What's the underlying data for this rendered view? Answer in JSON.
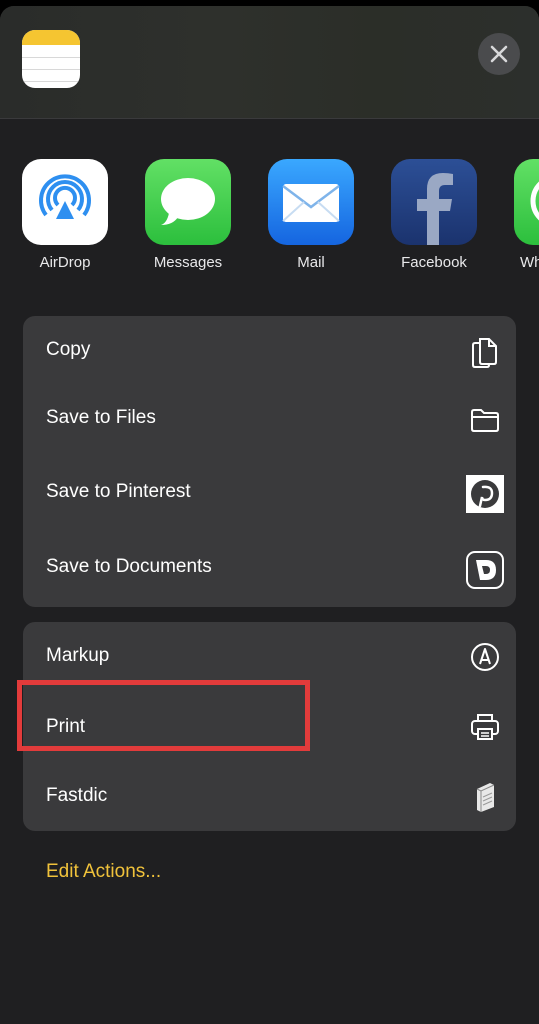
{
  "apps": [
    {
      "label": "AirDrop",
      "icon": "airdrop-icon"
    },
    {
      "label": "Messages",
      "icon": "messages-icon"
    },
    {
      "label": "Mail",
      "icon": "mail-icon"
    },
    {
      "label": "Facebook",
      "icon": "facebook-icon"
    },
    {
      "label": "Wh",
      "icon": "whatsapp-icon"
    }
  ],
  "actions_group1": [
    {
      "label": "Copy",
      "icon": "copy-icon"
    },
    {
      "label": "Save to Files",
      "icon": "folder-icon"
    },
    {
      "label": "Save to Pinterest",
      "icon": "pinterest-icon"
    },
    {
      "label": "Save to Documents",
      "icon": "documents-icon"
    }
  ],
  "actions_group2": [
    {
      "label": "Markup",
      "icon": "markup-icon"
    },
    {
      "label": "Print",
      "icon": "printer-icon"
    },
    {
      "label": "Fastdic",
      "icon": "fastdic-icon"
    }
  ],
  "edit_actions": "Edit Actions...",
  "colors": {
    "accent": "#f0c23b",
    "highlight": "#e23b3b",
    "group_bg": "#3a3a3c",
    "sheet_bg": "#1f1f21"
  }
}
